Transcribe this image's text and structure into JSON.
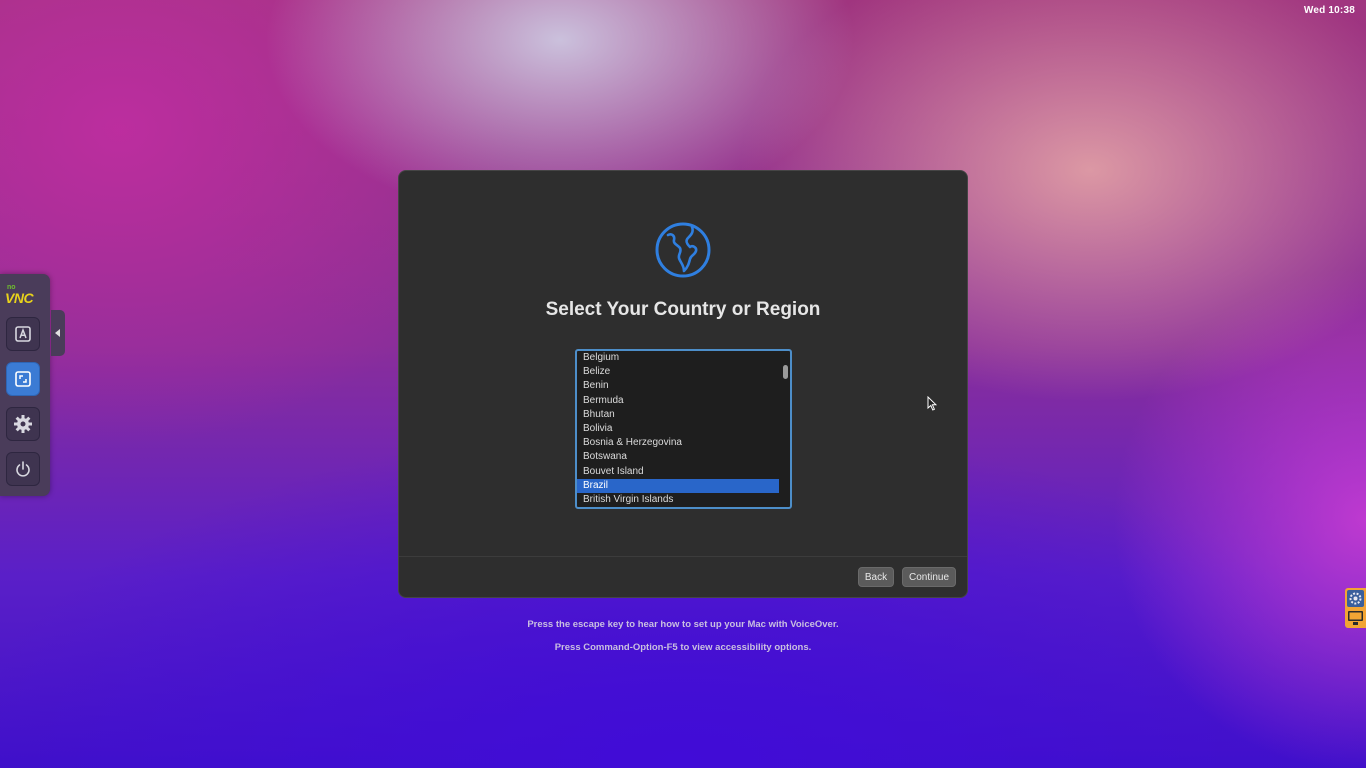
{
  "menubar": {
    "clock": "Wed 10:38"
  },
  "vnc_toolbar": {
    "logo_text": "VNC",
    "logo_prefix": "no",
    "buttons": [
      {
        "icon": "keyboard-a-icon",
        "active": false
      },
      {
        "icon": "fullscreen-icon",
        "active": true
      },
      {
        "icon": "gear-icon",
        "active": false
      },
      {
        "icon": "power-icon",
        "active": false
      }
    ],
    "handle_icon": "chevron-left-icon"
  },
  "dialog": {
    "icon": "globe-icon",
    "title": "Select Your Country or Region",
    "countries": [
      "Belgium",
      "Belize",
      "Benin",
      "Bermuda",
      "Bhutan",
      "Bolivia",
      "Bosnia & Herzegovina",
      "Botswana",
      "Bouvet Island",
      "Brazil",
      "British Virgin Islands"
    ],
    "selected": "Brazil",
    "back_label": "Back",
    "continue_label": "Continue"
  },
  "hints": {
    "voiceover": "Press the escape key to hear how to set up your Mac with VoiceOver.",
    "accessibility": "Press Command-Option-F5 to view accessibility options."
  },
  "colors": {
    "accent": "#2966c9",
    "dialog_bg": "#2e2e2e",
    "list_border": "#4d8ec9",
    "globe": "#2f7fe0"
  }
}
